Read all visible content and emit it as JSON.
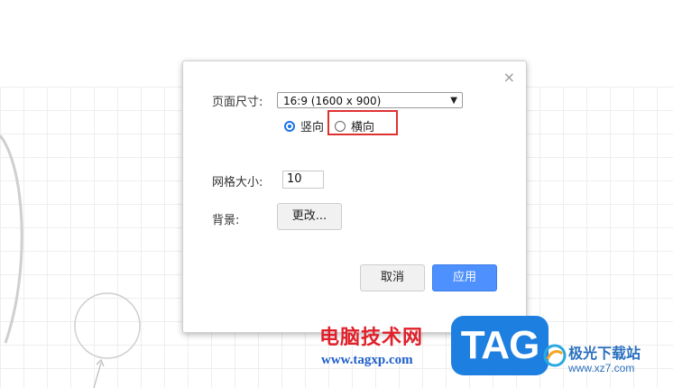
{
  "dialog": {
    "close_glyph": "×",
    "page_size_label": "页面尺寸:",
    "page_size_value": "16:9 (1600 x 900)",
    "orientation": {
      "portrait_label": "竖向",
      "landscape_label": "横向",
      "selected": "portrait"
    },
    "grid_size_label": "网格大小:",
    "grid_size_value": "10",
    "background_label": "背景:",
    "change_button": "更改...",
    "cancel_button": "取消",
    "apply_button": "应用"
  },
  "watermark": {
    "title": "电脑技术网",
    "url": "www.tagxp.com",
    "logo_text": "TAG",
    "site_name": "极光下载站",
    "site_url": "www.xz7.com"
  },
  "colors": {
    "accent": "#4d90fe",
    "highlight": "#e03131",
    "watermark_red": "#e0202a",
    "watermark_blue": "#1d7fe0"
  }
}
